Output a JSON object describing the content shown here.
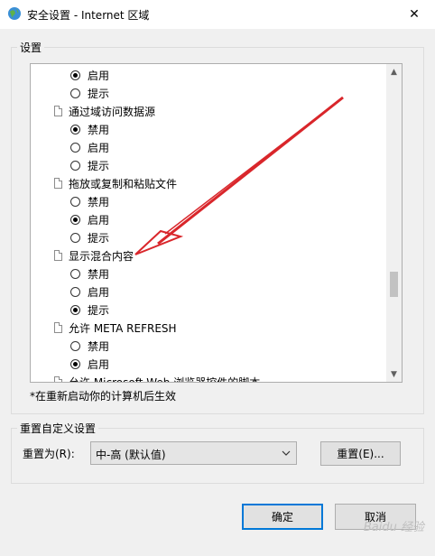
{
  "window": {
    "title": "安全设置 - Internet 区域",
    "close_label": "✕"
  },
  "settings_group": {
    "label": "设置",
    "rows": [
      {
        "kind": "radio",
        "label": "启用",
        "selected": true
      },
      {
        "kind": "radio",
        "label": "提示",
        "selected": false
      },
      {
        "kind": "item",
        "label": "通过域访问数据源"
      },
      {
        "kind": "radio",
        "label": "禁用",
        "selected": true
      },
      {
        "kind": "radio",
        "label": "启用",
        "selected": false
      },
      {
        "kind": "radio",
        "label": "提示",
        "selected": false
      },
      {
        "kind": "item",
        "label": "拖放或复制和粘贴文件"
      },
      {
        "kind": "radio",
        "label": "禁用",
        "selected": false
      },
      {
        "kind": "radio",
        "label": "启用",
        "selected": true
      },
      {
        "kind": "radio",
        "label": "提示",
        "selected": false
      },
      {
        "kind": "item",
        "label": "显示混合内容"
      },
      {
        "kind": "radio",
        "label": "禁用",
        "selected": false
      },
      {
        "kind": "radio",
        "label": "启用",
        "selected": false
      },
      {
        "kind": "radio",
        "label": "提示",
        "selected": true
      },
      {
        "kind": "item",
        "label": "允许 META REFRESH"
      },
      {
        "kind": "radio",
        "label": "禁用",
        "selected": false
      },
      {
        "kind": "radio",
        "label": "启用",
        "selected": true
      },
      {
        "kind": "item",
        "label": "允许 Microsoft Web 浏览器控件的脚本"
      }
    ],
    "note": "*在重新启动你的计算机后生效"
  },
  "reset_group": {
    "label": "重置自定义设置",
    "reset_to_label": "重置为(R):",
    "selected_level": "中-高 (默认值)",
    "reset_button": "重置(E)..."
  },
  "buttons": {
    "ok": "确定",
    "cancel": "取消"
  },
  "watermark": "Baidu 经验",
  "colors": {
    "annotation_arrow": "#d9262b",
    "focus_border": "#0078d7"
  }
}
